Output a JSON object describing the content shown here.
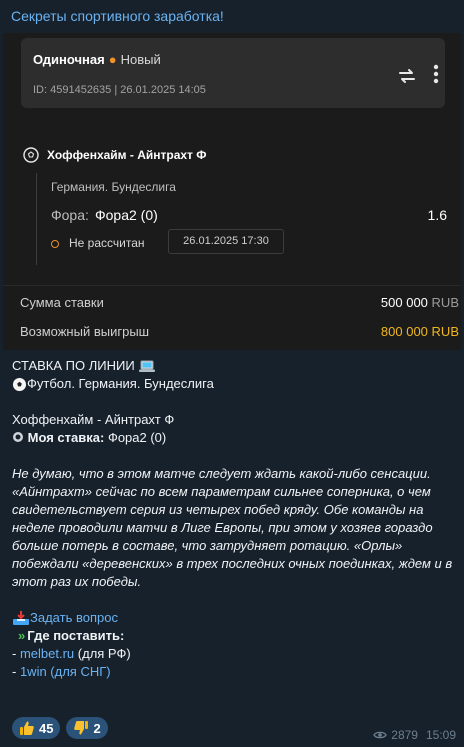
{
  "channel": {
    "title": "Секреты спортивного заработка!"
  },
  "card": {
    "bet_type": "Одиночная",
    "bet_status": "Новый",
    "bet_id_line": "ID: 4591452635 | 26.01.2025 14:05",
    "match": "Хоффенхайм - Айнтрахт Ф",
    "league": "Германия. Бундеслига",
    "fora_label": "Фора:",
    "fora_value": "Фора2 (0)",
    "odds": "1.6",
    "pending_text": "Не рассчитан",
    "event_date": "26.01.2025 17:30",
    "stake_label": "Сумма ставки",
    "stake_amount": "500 000",
    "stake_currency": "RUB",
    "win_label": "Возможный выигрыш",
    "win_amount": "800 000",
    "win_currency": "RUB",
    "accent_orange": "#f0912a",
    "accent_gold": "#f0b71e"
  },
  "message": {
    "line_heading": "СТАВКА ПО ЛИНИИ",
    "sport_line": "Футбол. Германия. Бундеслига",
    "match_line": "Хоффенхайм - Айнтрахт Ф",
    "my_bet_label": "Моя ставка:",
    "my_bet_value": "Фора2 (0)",
    "analysis": "Не думаю, что в этом матче следует ждать какой-либо сенсации. «Айнтрахт» сейчас по всем параметрам сильнее соперника, о чем свидетельствует серия из четырех побед кряду. Обе команды на неделе проводили матчи в Лиге Европы, при этом у хозяев гораздо больше потерь в составе, что затрудняет ротацию. «Орлы» побеждали «деревенских» в трех последних очных поединках, ждем и в этот раз их победы.",
    "ask_link": "Задать вопрос",
    "where_label": "Где поставить:",
    "link1_site": "melbet.ru",
    "link1_note": "(для РФ)",
    "link2_site": "1win (для СНГ)"
  },
  "reactions": [
    {
      "icon": "thumbs-up-icon",
      "count": "45"
    },
    {
      "icon": "thumbs-down-icon",
      "count": "2"
    }
  ],
  "meta": {
    "views": "2879",
    "time": "15:09"
  }
}
